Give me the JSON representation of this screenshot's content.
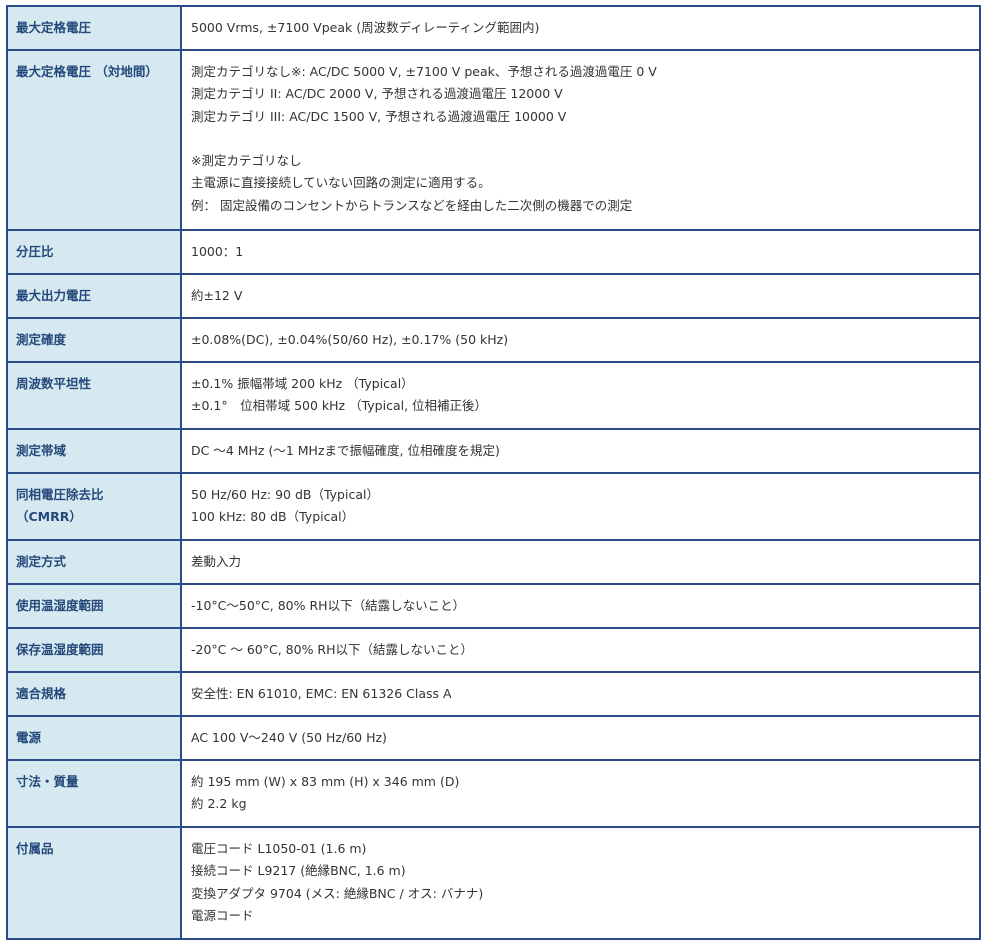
{
  "rows": [
    {
      "label": [
        "最大定格電圧"
      ],
      "value": [
        "5000 Vrms, ±7100 Vpeak (周波数ディレーティング範囲内)"
      ]
    },
    {
      "label": [
        "最大定格電圧 （対地間）"
      ],
      "value": [
        "測定カテゴリなし※: AC/DC 5000 V, ±7100 V peak、予想される過渡過電圧 0 V",
        "測定カテゴリ II: AC/DC 2000 V, 予想される過渡過電圧 12000 V",
        "測定カテゴリ III: AC/DC 1500 V, 予想される過渡過電圧 10000 V",
        "",
        "※測定カテゴリなし",
        "主電源に直接接続していない回路の測定に適用する。",
        "例： 固定設備のコンセントからトランスなどを経由した二次側の機器での測定"
      ]
    },
    {
      "label": [
        "分圧比"
      ],
      "value": [
        "1000：1"
      ]
    },
    {
      "label": [
        "最大出力電圧"
      ],
      "value": [
        "約±12 V"
      ]
    },
    {
      "label": [
        "測定確度"
      ],
      "value": [
        "±0.08%(DC), ±0.04%(50/60 Hz), ±0.17% (50 kHz)"
      ]
    },
    {
      "label": [
        "周波数平坦性"
      ],
      "value": [
        "±0.1% 振幅帯域 200 kHz （Typical）",
        "±0.1°　位相帯域 500 kHz （Typical, 位相補正後）"
      ]
    },
    {
      "label": [
        "測定帯域"
      ],
      "value": [
        "DC ～4 MHz (～1 MHzまで振幅確度, 位相確度を規定)"
      ]
    },
    {
      "label": [
        "同相電圧除去比",
        "（CMRR）"
      ],
      "value": [
        "50 Hz/60 Hz: 90 dB（Typical）",
        "100 kHz: 80 dB（Typical）"
      ]
    },
    {
      "label": [
        "測定方式"
      ],
      "value": [
        "差動入力"
      ]
    },
    {
      "label": [
        "使用温湿度範囲"
      ],
      "value": [
        "-10°C～50°C, 80% RH以下（結露しないこと）"
      ]
    },
    {
      "label": [
        "保存温湿度範囲"
      ],
      "value": [
        "-20°C ～ 60°C, 80% RH以下（結露しないこと）"
      ]
    },
    {
      "label": [
        "適合規格"
      ],
      "value": [
        "安全性: EN 61010, EMC: EN 61326 Class A"
      ]
    },
    {
      "label": [
        "電源"
      ],
      "value": [
        "AC 100 V～240 V (50 Hz/60 Hz)"
      ]
    },
    {
      "label": [
        "寸法・質量"
      ],
      "value": [
        "約 195 mm (W) x 83 mm (H) x 346 mm (D)",
        "約 2.2 kg"
      ]
    },
    {
      "label": [
        "付属品"
      ],
      "value": [
        "電圧コード L1050-01 (1.6 m)",
        "接続コード L9217 (絶縁BNC, 1.6 m)",
        "変換アダプタ 9704 (メス: 絶縁BNC / オス: バナナ)",
        "電源コード"
      ]
    }
  ],
  "colors": {
    "border": "#2b4c86",
    "label_background": "#d6e9f1",
    "label_text": "#24487a",
    "value_text": "#333333"
  }
}
